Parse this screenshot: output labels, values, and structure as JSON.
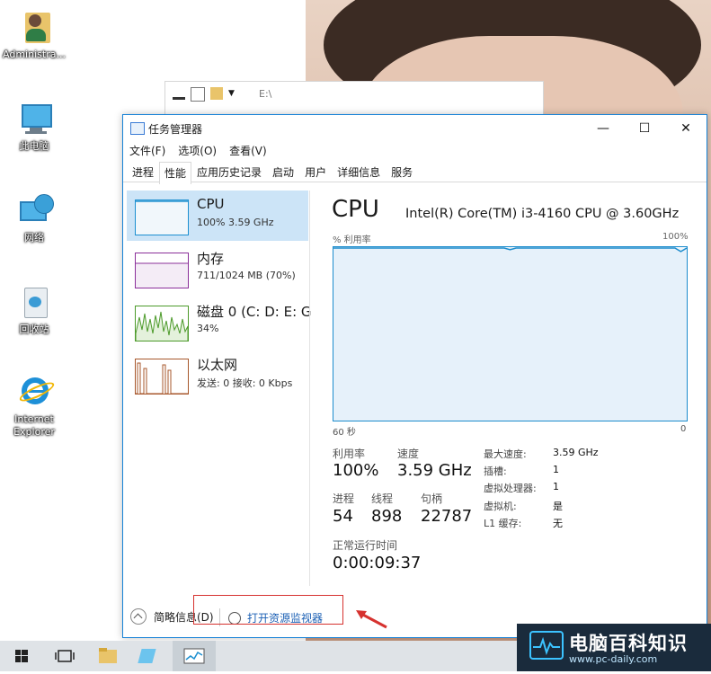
{
  "desktop": {
    "icons": [
      {
        "label": "Administra..."
      },
      {
        "label": "此电脑"
      },
      {
        "label": "网络"
      },
      {
        "label": "回收站"
      },
      {
        "label": "Internet Explorer"
      }
    ]
  },
  "explorer": {
    "path": "E:\\"
  },
  "window": {
    "title": "任务管理器",
    "controls": {
      "minimize": "—",
      "maximize": "☐",
      "close": "✕"
    }
  },
  "menu": [
    "文件(F)",
    "选项(O)",
    "查看(V)"
  ],
  "tabs": [
    "进程",
    "性能",
    "应用历史记录",
    "启动",
    "用户",
    "详细信息",
    "服务"
  ],
  "active_tab": "性能",
  "resources": [
    {
      "name": "CPU",
      "sub": "100% 3.59 GHz",
      "color": "#1c8fd0"
    },
    {
      "name": "内存",
      "sub": "711/1024 MB (70%)",
      "color": "#8b2f9a"
    },
    {
      "name": "磁盘 0 (C: D: E: G",
      "sub": "34%",
      "color": "#4c9a2a"
    },
    {
      "name": "以太网",
      "sub": "发送: 0 接收: 0 Kbps",
      "color": "#a7572b"
    }
  ],
  "detail": {
    "title": "CPU",
    "model": "Intel(R) Core(TM) i3-4160 CPU @ 3.60GHz",
    "util_label": "% 利用率",
    "util_max": "100%",
    "axis_left": "60 秒",
    "axis_right": "0",
    "utilization_label": "利用率",
    "utilization_value": "100%",
    "speed_label": "速度",
    "speed_value": "3.59 GHz",
    "processes_label": "进程",
    "processes_value": "54",
    "threads_label": "线程",
    "threads_value": "898",
    "handles_label": "句柄",
    "handles_value": "22787",
    "uptime_label": "正常运行时间",
    "uptime_value": "0:00:09:37",
    "specs": [
      {
        "label": "最大速度:",
        "value": "3.59 GHz"
      },
      {
        "label": "插槽:",
        "value": "1"
      },
      {
        "label": "虚拟处理器:",
        "value": "1"
      },
      {
        "label": "虚拟机:",
        "value": "是"
      },
      {
        "label": "L1 缓存:",
        "value": "无"
      }
    ],
    "cpu_history_percent": [
      100,
      100,
      100,
      100,
      100,
      100,
      100,
      100,
      100,
      100,
      100,
      100,
      100,
      100,
      100,
      100,
      100,
      100,
      100,
      100,
      100,
      100,
      100,
      100,
      100,
      100,
      100,
      100,
      100,
      100,
      99,
      100,
      100,
      100,
      100,
      100,
      100,
      100,
      100,
      100,
      100,
      100,
      100,
      100,
      100,
      100,
      100,
      100,
      100,
      100,
      100,
      100,
      100,
      100,
      100,
      100,
      100,
      100,
      100,
      98,
      100
    ]
  },
  "footer": {
    "fewer_details": "简略信息(D)",
    "resource_monitor": "打开资源监视器"
  },
  "watermark": {
    "title": "电脑百科知识",
    "url": "www.pc-daily.com"
  },
  "colors": {
    "accent": "#1883d7",
    "graph_line": "#1d8ccd",
    "graph_fill": "#f1f7fb",
    "highlight_box": "#d6322f"
  }
}
